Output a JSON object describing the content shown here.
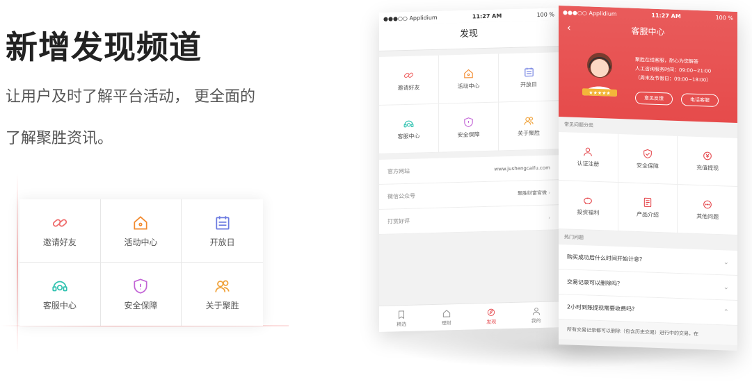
{
  "headline": "新增发现频道",
  "description": {
    "line1": "让用户及时了解平台活动， 更全面的",
    "line2": "了解聚胜资讯。"
  },
  "feature_grid": [
    {
      "label": "邀请好友",
      "icon": "link-icon"
    },
    {
      "label": "活动中心",
      "icon": "home-icon"
    },
    {
      "label": "开放日",
      "icon": "calendar-icon"
    },
    {
      "label": "客服中心",
      "icon": "headset-icon"
    },
    {
      "label": "安全保障",
      "icon": "shield-icon"
    },
    {
      "label": "关于聚胜",
      "icon": "users-icon"
    }
  ],
  "phone1": {
    "carrier": "●●●○○ Applidium",
    "time": "11:27 AM",
    "battery": "100 %",
    "title": "发现",
    "grid": [
      {
        "label": "邀请好友"
      },
      {
        "label": "活动中心"
      },
      {
        "label": "开放日"
      },
      {
        "label": "客服中心"
      },
      {
        "label": "安全保障"
      },
      {
        "label": "关于聚胜"
      }
    ],
    "rows": [
      {
        "label": "官方网站",
        "value": "www.jushengcaifu.com"
      },
      {
        "label": "微信公众号",
        "value": "聚胜财富官微"
      },
      {
        "label": "打赏好评",
        "value": ""
      }
    ],
    "tabs": [
      "精选",
      "理财",
      "发现",
      "我的"
    ]
  },
  "phone2": {
    "carrier": "●●●○○ Applidium",
    "time": "11:27 AM",
    "battery": "100 %",
    "title": "客服中心",
    "info": {
      "l1": "聚胜在线客服，耐心为您解答",
      "l2": "人工咨询服务时间：09:00~21:00",
      "l3": "（周末及节假日：09:00~18:00）"
    },
    "btn_feedback": "意见反馈",
    "btn_call": "电话客服",
    "section_common": "常见问题分类",
    "grid": [
      {
        "label": "认证注册"
      },
      {
        "label": "安全保障"
      },
      {
        "label": "充值提现"
      },
      {
        "label": "投资福利"
      },
      {
        "label": "产品介绍"
      },
      {
        "label": "其他问题"
      }
    ],
    "section_hot": "热门问题",
    "questions": [
      "购买成功后什么时间开始计息？",
      "交易记录可以删除吗？",
      "2小时到账提现需要收费吗？"
    ],
    "answer": "所有交易记录都可以删除（包含历史交易）进行中的交易，在"
  }
}
